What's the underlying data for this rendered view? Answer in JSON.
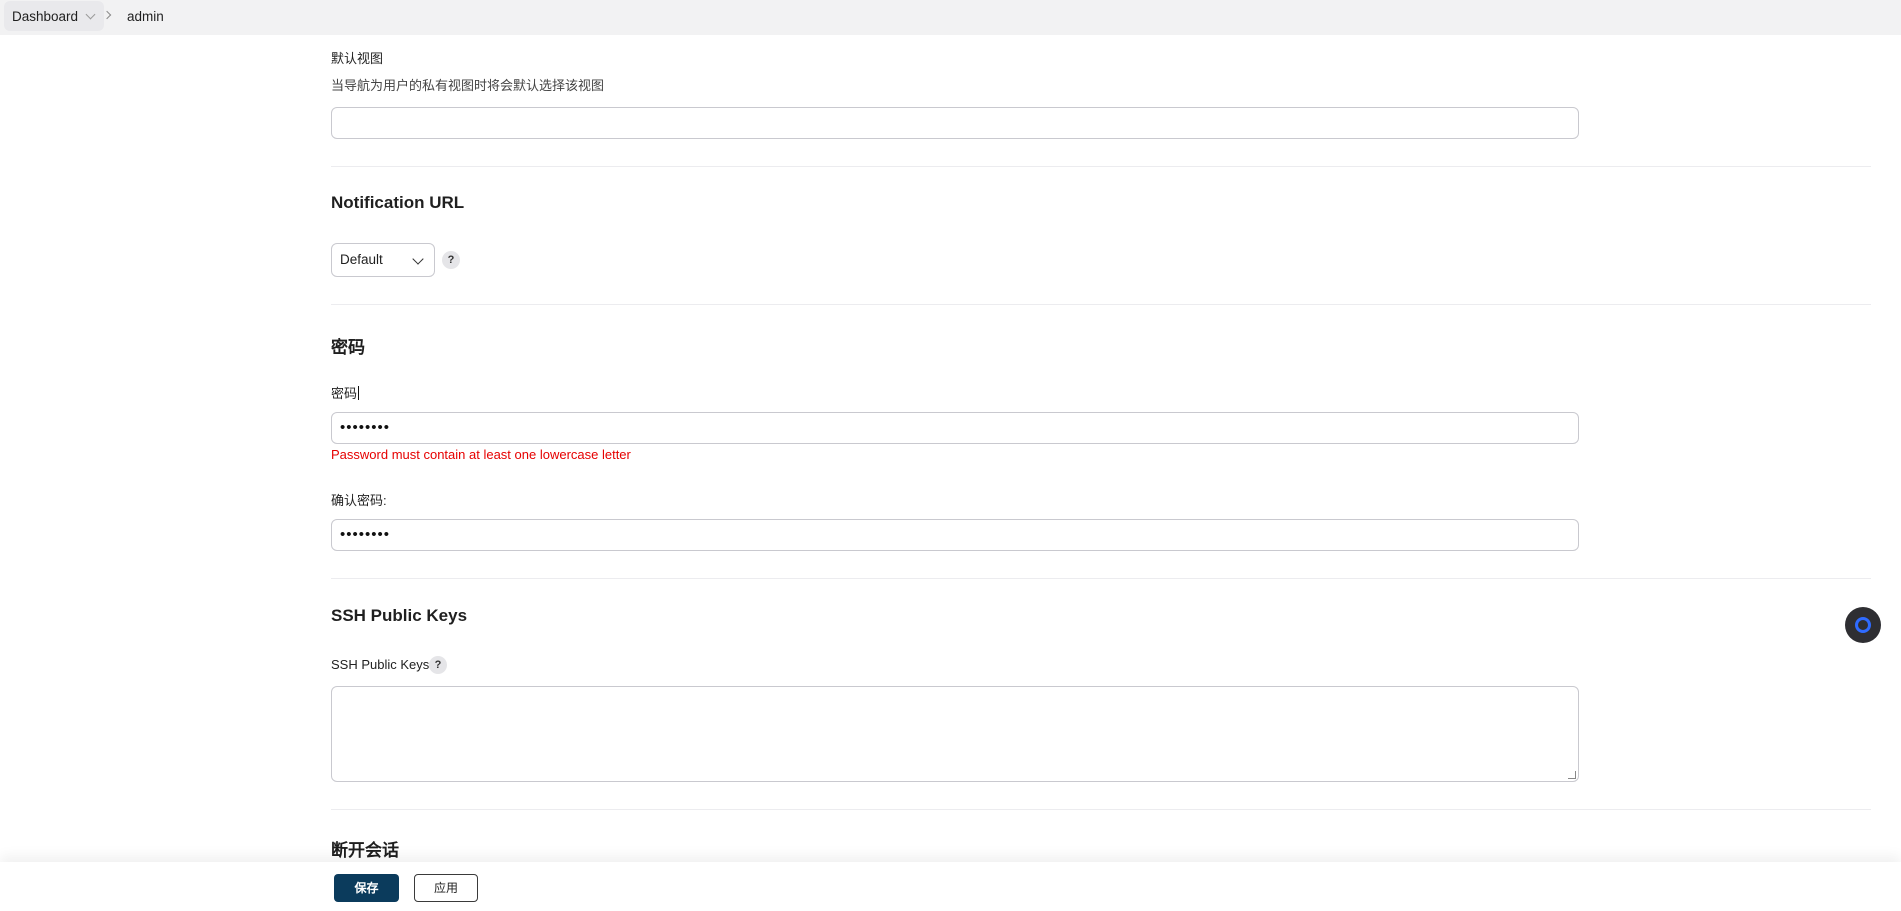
{
  "breadcrumb": {
    "items": [
      {
        "label": "Dashboard"
      },
      {
        "label": "admin"
      }
    ]
  },
  "default_view": {
    "label": "默认视图",
    "description": "当导航为用户的私有视图时将会默认选择该视图",
    "value": ""
  },
  "notification_url": {
    "title": "Notification URL",
    "select_value": "Default",
    "help": "?"
  },
  "password": {
    "title": "密码",
    "label": "密码",
    "value": "••••••••",
    "error": "Password must contain at least one lowercase letter",
    "confirm_label": "确认密码:",
    "confirm_value": "••••••••"
  },
  "ssh": {
    "title": "SSH Public Keys",
    "label": "SSH Public Keys",
    "help": "?",
    "value": ""
  },
  "session": {
    "title": "断开会话"
  },
  "actions": {
    "save_label": "保存",
    "apply_label": "应用"
  },
  "icons": {
    "breadcrumb_dropdown": "chevron-down-icon",
    "breadcrumb_separator": "chevron-right-icon",
    "select_arrow": "chevron-down-icon",
    "floating_button": "ring-icon"
  },
  "colors": {
    "save_button": "#0b3b5c",
    "error_text": "#e60000",
    "floating_ring": "#2f6bff"
  }
}
